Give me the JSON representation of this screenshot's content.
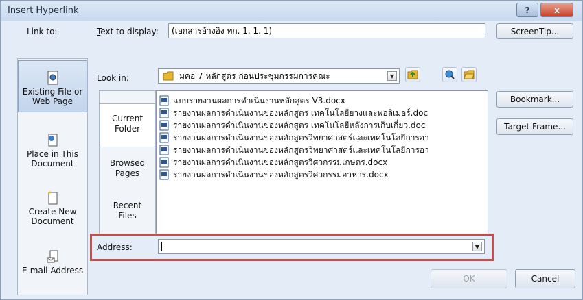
{
  "window": {
    "title": "Insert Hyperlink",
    "help_label": "?",
    "close_label": "x"
  },
  "link_to": {
    "label": "Link to:",
    "items": [
      {
        "label": "Existing File or Web Page",
        "icon": "existing-file-icon",
        "selected": true
      },
      {
        "label": "Place in This Document",
        "icon": "place-in-document-icon",
        "selected": false
      },
      {
        "label": "Create New Document",
        "icon": "create-new-document-icon",
        "selected": false
      },
      {
        "label": "E-mail Address",
        "icon": "email-address-icon",
        "selected": false
      }
    ]
  },
  "text_to_display": {
    "label": "Text to display:",
    "value": "(เอกสารอ้างอิง ทก. 1. 1. 1)"
  },
  "screentip": {
    "label": "ScreenTip..."
  },
  "look_in": {
    "label": "Look in:",
    "value": "มคอ 7 หลักสูตร ก่อนประชุมกรรมการคณะ"
  },
  "sub_nav": [
    {
      "label": "Current Folder",
      "selected": true
    },
    {
      "label": "Browsed Pages",
      "selected": false
    },
    {
      "label": "Recent Files",
      "selected": false
    }
  ],
  "files": [
    "แบบรายงานผลการดำเนินงานหลักสูตร V3.docx",
    "รายงานผลการดำเนินงานของหลักสูตร เทคโนโลยียางและพอลิเมอร์.doc",
    "รายงานผลการดำเนินงานของหลักสูตร เทคโนโลยีหลังการเก็บเกี่ยว.doc",
    "รายงานผลการดำเนินงานของหลักสูตรวิทยาศาสตร์และเทคโนโลยีการอา",
    "รายงานผลการดำเนินงานของหลักสูตรวิทยาศาสตร์และเทคโนโลยีการอา",
    "รายงานผลการดำเนินงานของหลักสูตรวิศวกรรมเกษตร.docx",
    "รายงานผลการดำเนินงานของหลักสูตรวิศวกรรมอาหาร.docx"
  ],
  "side_buttons": {
    "bookmark": "Bookmark...",
    "target_frame": "Target Frame..."
  },
  "address": {
    "label": "Address:",
    "value": ""
  },
  "footer": {
    "ok": "OK",
    "cancel": "Cancel"
  },
  "colors": {
    "highlight": "#c0504d",
    "dialog_bg": "#e4ecf7"
  }
}
